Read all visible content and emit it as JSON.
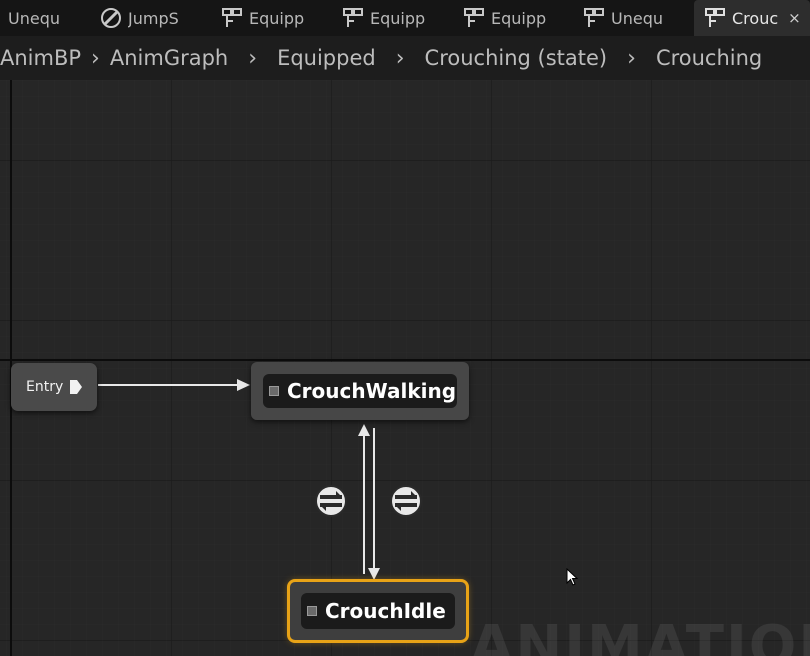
{
  "tabs": [
    {
      "label": "Unequ",
      "icon": "none",
      "active": false
    },
    {
      "label": "JumpS",
      "icon": "blendspace-icon",
      "active": false
    },
    {
      "label": "Equipp",
      "icon": "statemachine-icon",
      "active": false
    },
    {
      "label": "Equipp",
      "icon": "statemachine-icon",
      "active": false
    },
    {
      "label": "Equipp",
      "icon": "statemachine-icon",
      "active": false
    },
    {
      "label": "Unequ",
      "icon": "statemachine-icon",
      "active": false
    },
    {
      "label": "Crouc",
      "icon": "statemachine-icon",
      "active": true,
      "close": "×"
    }
  ],
  "breadcrumb": [
    "AnimBP",
    "AnimGraph",
    "Equipped",
    "Crouching (state)",
    "Crouching"
  ],
  "graph": {
    "entry_label": "Entry",
    "states": [
      {
        "name": "CrouchWalking",
        "selected": false
      },
      {
        "name": "CrouchIdle",
        "selected": true
      }
    ],
    "watermark": "ANIMATION"
  },
  "colors": {
    "background": "#262626",
    "selection": "#e8a317",
    "node": "#474747"
  }
}
